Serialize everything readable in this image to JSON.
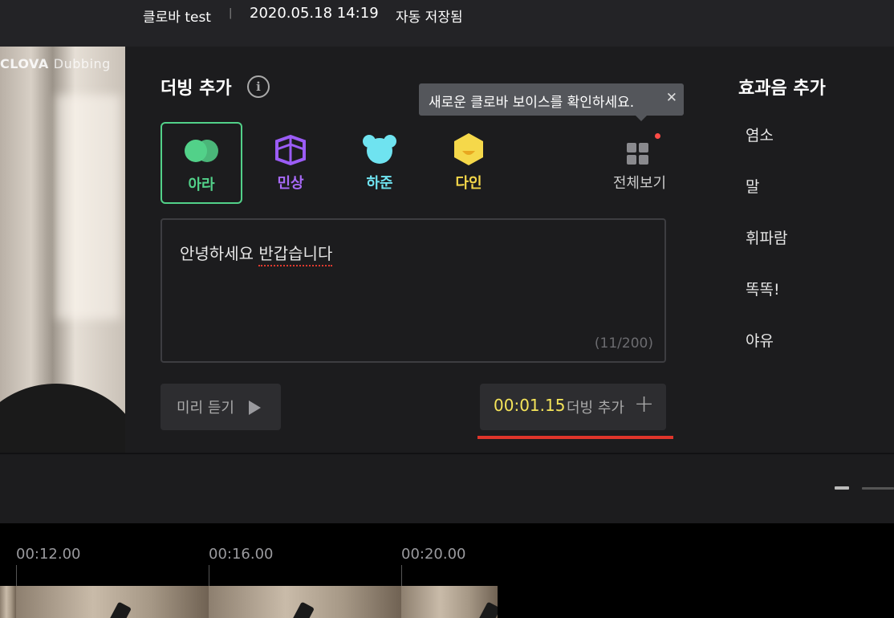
{
  "header": {
    "project_name": "클로바 test",
    "separator": "|",
    "save_time": "2020.05.18 14:19",
    "save_status": "자동 저장됨"
  },
  "preview": {
    "logo_bold": "CLOVA",
    "logo_light": "Dubbing"
  },
  "dubbing": {
    "title": "더빙 추가",
    "info_icon": "i",
    "tooltip": {
      "text": "새로운 클로바 보이스를 확인하세요.",
      "close": "✕"
    },
    "voices": [
      {
        "label": "아라",
        "color": "#52d189",
        "icon": "ara-heart-icon",
        "selected": true
      },
      {
        "label": "민상",
        "color": "#9b5cf6",
        "icon": "minsang-book-icon",
        "selected": false
      },
      {
        "label": "하준",
        "color": "#6fe3f0",
        "icon": "hajun-bear-icon",
        "selected": false
      },
      {
        "label": "다인",
        "color": "#f5d84a",
        "icon": "dain-hexagon-icon",
        "selected": false
      }
    ],
    "all_view_label": "전체보기",
    "text_content_plain": "안녕하세요 ",
    "text_content_marked": "반갑습니다",
    "char_count": "(11/200)",
    "preview_button": "미리 듣기",
    "add_time": "00:01.15",
    "add_label": "더빙 추가",
    "add_plus": "+"
  },
  "sfx": {
    "title": "효과음 추가",
    "items": [
      "염소",
      "말",
      "휘파람",
      "똑똑!",
      "야유"
    ]
  },
  "timeline": {
    "ticks": [
      "00:12.00",
      "00:16.00",
      "00:20.00"
    ]
  },
  "colors": {
    "accent_green": "#52d189",
    "accent_yellow": "#f5e45a",
    "alert_red": "#e0352b",
    "panel_bg": "#1c1c1e"
  }
}
